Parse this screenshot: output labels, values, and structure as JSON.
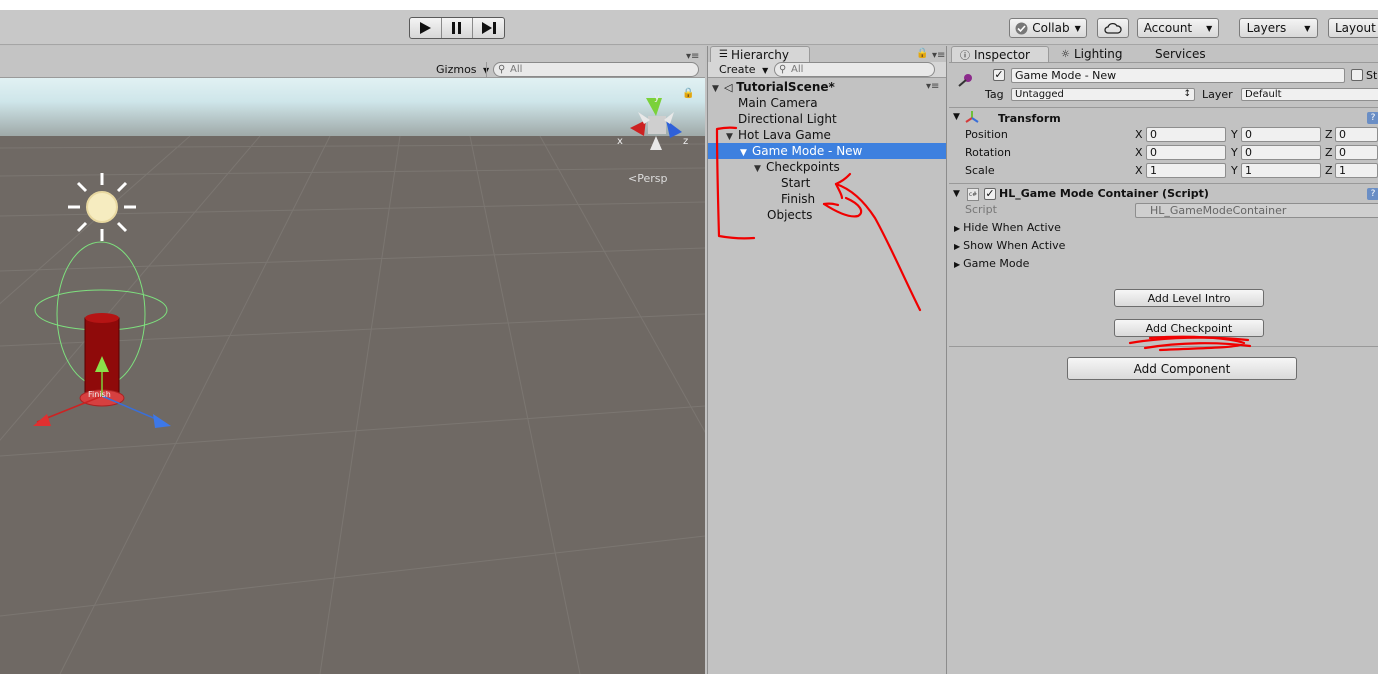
{
  "toolbar": {
    "collab_label": "Collab",
    "account_label": "Account",
    "layers_label": "Layers",
    "layout_label": "Layout"
  },
  "scene": {
    "gizmos_label": "Gizmos",
    "search_placeholder": "All",
    "persp_label": "Persp",
    "axis_x": "x",
    "axis_y": "y",
    "axis_z": "z",
    "object_label": "Finish"
  },
  "hierarchy": {
    "tab_label": "Hierarchy",
    "create_label": "Create",
    "search_placeholder": "All",
    "scene_name": "TutorialScene*",
    "items": [
      {
        "label": "Main Camera"
      },
      {
        "label": "Directional Light"
      },
      {
        "label": "Hot Lava Game"
      },
      {
        "label": "Game Mode - New"
      },
      {
        "label": "Checkpoints"
      },
      {
        "label": "Start"
      },
      {
        "label": "Finish"
      },
      {
        "label": "Objects"
      }
    ]
  },
  "inspector": {
    "tabs": [
      "Inspector",
      "Lighting",
      "Services"
    ],
    "object_name": "Game Mode - New",
    "static_label": "St",
    "tag_label": "Tag",
    "tag_value": "Untagged",
    "layer_label": "Layer",
    "layer_value": "Default",
    "transform": {
      "title": "Transform",
      "rows": [
        {
          "label": "Position",
          "x": "0",
          "y": "0",
          "z": "0"
        },
        {
          "label": "Rotation",
          "x": "0",
          "y": "0",
          "z": "0"
        },
        {
          "label": "Scale",
          "x": "1",
          "y": "1",
          "z": "1"
        }
      ],
      "x_label": "X",
      "y_label": "Y",
      "z_label": "Z"
    },
    "script_component": {
      "title": "HL_Game Mode Container (Script)",
      "script_label": "Script",
      "script_value": "HL_GameModeContainer",
      "foldouts": [
        "Hide When Active",
        "Show When Active",
        "Game Mode"
      ],
      "add_level_intro": "Add Level Intro",
      "add_checkpoint": "Add Checkpoint"
    },
    "add_component": "Add Component"
  }
}
